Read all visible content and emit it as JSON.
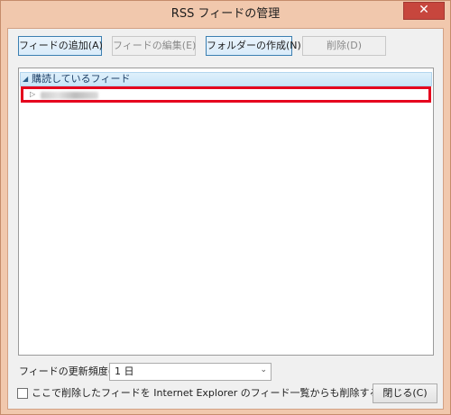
{
  "window": {
    "title": "RSS フィードの管理",
    "close_glyph": "✕"
  },
  "toolbar": {
    "add_label": "フィードの追加(A)",
    "edit_label": "フィードの編集(E)",
    "folder_label": "フォルダーの作成(N)",
    "delete_label": "削除(D)"
  },
  "feed_list": {
    "group_label": "購読しているフィード",
    "group_arrow": "◢",
    "item_arrow": "▷"
  },
  "settings": {
    "frequency_label": "フィードの更新頻度(U):",
    "frequency_value": "1 日",
    "frequency_arrow": "⌄",
    "checkbox_label": "ここで削除したフィードを Internet Explorer のフィード一覧からも削除する(E)"
  },
  "footer": {
    "close_label": "閉じる(C)"
  },
  "colors": {
    "frame": "#f1c8ad",
    "highlight": "#e5001e",
    "close_button": "#c7463d"
  }
}
